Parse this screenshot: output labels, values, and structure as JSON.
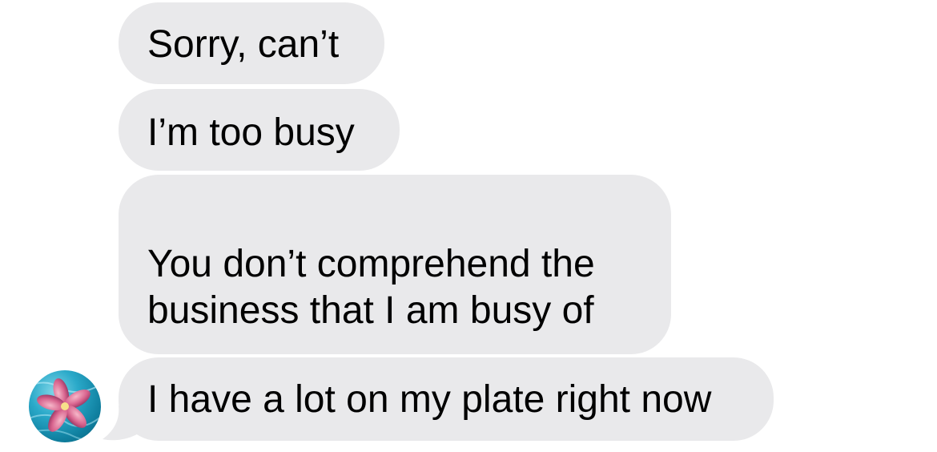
{
  "conversation": {
    "messages": [
      {
        "sender": "incoming",
        "text": "Sorry, can’t"
      },
      {
        "sender": "incoming",
        "text": "I’m too busy"
      },
      {
        "sender": "incoming",
        "lines": [
          "You don’t comprehend the",
          "business that I am busy of"
        ]
      },
      {
        "sender": "incoming",
        "text": "I have a lot on my plate right now"
      }
    ],
    "avatar": {
      "icon": "flower-in-pool-avatar"
    }
  },
  "colors": {
    "bubble_incoming": "#e9e9eb",
    "text": "#000000",
    "background": "#ffffff"
  }
}
